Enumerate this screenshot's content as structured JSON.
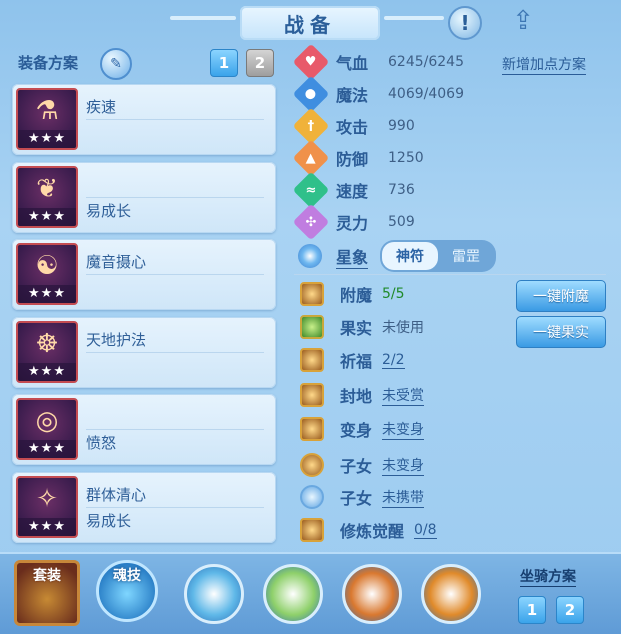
{
  "header": {
    "title": "战备"
  },
  "loadout": {
    "label": "装备方案",
    "plans": [
      "1",
      "2"
    ],
    "active_plan": "1",
    "skills": [
      {
        "name": "疾速",
        "stars": "★★★",
        "name_position": "top",
        "icon": "potion-icon"
      },
      {
        "name": "易成长",
        "stars": "★★★",
        "name_position": "bottom",
        "icon": "vine-icon"
      },
      {
        "name": "魔音摄心",
        "stars": "★★★",
        "name_position": "top",
        "icon": "sorcerer-icon"
      },
      {
        "name": "天地护法",
        "stars": "★★★",
        "name_position": "top",
        "icon": "dragon-icon"
      },
      {
        "name": "愤怒",
        "stars": "★★★",
        "name_position": "bottom",
        "icon": "ring-icon"
      },
      {
        "name": "群体清心",
        "stars": "★★★",
        "name_position": "top",
        "sub": "易成长",
        "icon": "mage-icon"
      }
    ]
  },
  "stats": {
    "add_plan_link": "新增加点方案",
    "rows": [
      {
        "label": "气血",
        "value": "6245/6245",
        "icon": "heart-icon",
        "color": "#e85a6a"
      },
      {
        "label": "魔法",
        "value": "4069/4069",
        "icon": "mana-icon",
        "color": "#3f8ee0"
      },
      {
        "label": "攻击",
        "value": "990",
        "icon": "sword-icon",
        "color": "#f0b23a"
      },
      {
        "label": "防御",
        "value": "1250",
        "icon": "shield-icon",
        "color": "#f0914a"
      },
      {
        "label": "速度",
        "value": "736",
        "icon": "speed-icon",
        "color": "#2fc08a"
      },
      {
        "label": "灵力",
        "value": "509",
        "icon": "spirit-icon",
        "color": "#c07de0"
      }
    ],
    "star": {
      "label": "星象",
      "options": [
        "神符",
        "雷罡"
      ],
      "active": "神符"
    }
  },
  "features": [
    {
      "label": "附魔",
      "value": "5/5",
      "style": "green",
      "icon": "enchant-icon",
      "icon_style": ""
    },
    {
      "label": "果实",
      "value": "未使用",
      "style": "plain",
      "icon": "fruit-icon",
      "icon_style": "green"
    },
    {
      "label": "祈福",
      "value": "2/2",
      "style": "green-underline",
      "icon": "blessing-icon",
      "icon_style": ""
    },
    {
      "label": "封地",
      "value": "未受赏",
      "style": "underline",
      "icon": "fief-icon",
      "icon_style": ""
    },
    {
      "label": "变身",
      "value": "未变身",
      "style": "underline",
      "icon": "transform-icon",
      "icon_style": ""
    },
    {
      "label": "子女",
      "value": "未变身",
      "style": "underline",
      "icon": "child-icon",
      "icon_style": "round"
    },
    {
      "label": "子女",
      "value": "未携带",
      "style": "underline",
      "icon": "paw-icon",
      "icon_style": "round blue"
    },
    {
      "label": "修炼觉醒",
      "value": "0/8",
      "style": "underline",
      "icon": "cultivation-icon",
      "icon_style": ""
    }
  ],
  "actions": {
    "enchant_all": "一键附魔",
    "fruit_all": "一键果实"
  },
  "bottom": {
    "set_label": "套装",
    "soul_label": "魂技",
    "mount_label": "坐骑方案",
    "mount_plans": [
      "1",
      "2"
    ],
    "orbs": [
      {
        "icon": "meditate-orb-icon",
        "color": "#5fb8e8"
      },
      {
        "icon": "leaf-orb-icon",
        "color": "#8ed06a"
      },
      {
        "icon": "beast-orb-icon",
        "color": "#d9782f"
      },
      {
        "icon": "flame-orb-icon",
        "color": "#e08a2a"
      }
    ]
  }
}
